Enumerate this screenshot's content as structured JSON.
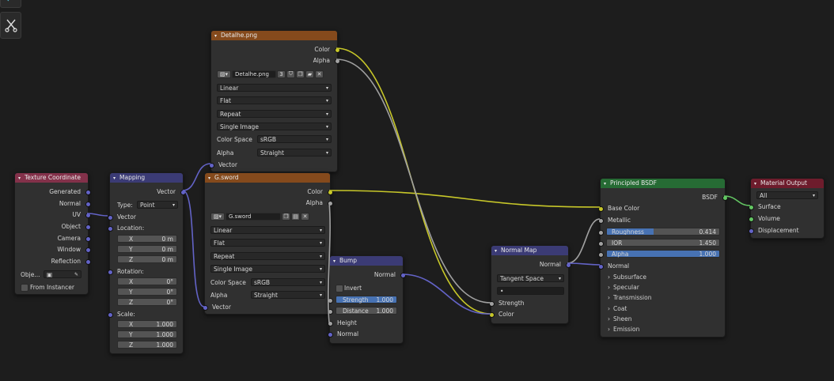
{
  "toolbar": {
    "top_icon": "node-tool-icon",
    "tool_icon": "cut-links-icon"
  },
  "nodes": {
    "texcoord": {
      "title": "Texture Coordinate",
      "outputs": [
        "Generated",
        "Normal",
        "UV",
        "Object",
        "Camera",
        "Window",
        "Reflection"
      ],
      "object_label": "Obje...",
      "from_instancer": "From Instancer",
      "header_color": "#83314a"
    },
    "mapping": {
      "title": "Mapping",
      "output": "Vector",
      "type_label": "Type:",
      "type_value": "Point",
      "input_vector": "Vector",
      "location_label": "Location:",
      "location": [
        {
          "axis": "X",
          "value": "0 m"
        },
        {
          "axis": "Y",
          "value": "0 m"
        },
        {
          "axis": "Z",
          "value": "0 m"
        }
      ],
      "rotation_label": "Rotation:",
      "rotation": [
        {
          "axis": "X",
          "value": "0°"
        },
        {
          "axis": "Y",
          "value": "0°"
        },
        {
          "axis": "Z",
          "value": "0°"
        }
      ],
      "scale_label": "Scale:",
      "scale": [
        {
          "axis": "X",
          "value": "1.000"
        },
        {
          "axis": "Y",
          "value": "1.000"
        },
        {
          "axis": "Z",
          "value": "1.000"
        }
      ],
      "header_color": "#3b3b75"
    },
    "detalhe": {
      "title": "Detalhe.png",
      "outputs": [
        "Color",
        "Alpha"
      ],
      "image_name": "Detalhe.png",
      "users": "3",
      "interpolation": "Linear",
      "projection": "Flat",
      "extension": "Repeat",
      "source": "Single Image",
      "color_space_label": "Color Space",
      "color_space": "sRGB",
      "alpha_label": "Alpha",
      "alpha": "Straight",
      "input_vector": "Vector",
      "header_color": "#854a1c"
    },
    "gsword": {
      "title": "G.sword",
      "outputs": [
        "Color",
        "Alpha"
      ],
      "image_name": "G.sword",
      "interpolation": "Linear",
      "projection": "Flat",
      "extension": "Repeat",
      "source": "Single Image",
      "color_space_label": "Color Space",
      "color_space": "sRGB",
      "alpha_label": "Alpha",
      "alpha": "Straight",
      "input_vector": "Vector",
      "header_color": "#854a1c"
    },
    "bump": {
      "title": "Bump",
      "output": "Normal",
      "invert": "Invert",
      "strength_label": "Strength",
      "strength": "1.000",
      "distance_label": "Distance",
      "distance": "1.000",
      "height": "Height",
      "normal": "Normal",
      "header_color": "#3b3b75"
    },
    "normalmap": {
      "title": "Normal Map",
      "output": "Normal",
      "space": "Tangent Space",
      "uv_value": "•",
      "strength": "Strength",
      "color": "Color",
      "header_color": "#3b3b75"
    },
    "principled": {
      "title": "Principled BSDF",
      "output": "BSDF",
      "base_color": "Base Color",
      "metallic": "Metallic",
      "roughness_label": "Roughness",
      "roughness": "0.414",
      "roughness_fraction": 0.414,
      "ior_label": "IOR",
      "ior": "1.450",
      "alpha_label": "Alpha",
      "alpha": "1.000",
      "normal": "Normal",
      "panels": [
        "Subsurface",
        "Specular",
        "Transmission",
        "Coat",
        "Sheen",
        "Emission"
      ],
      "header_color": "#266b34"
    },
    "output": {
      "title": "Material Output",
      "target": "All",
      "inputs": [
        "Surface",
        "Volume",
        "Displacement"
      ],
      "header_color": "#6e1c2c"
    }
  },
  "colors": {
    "wire_color": "#c7c729",
    "wire_vector": "#6363c7",
    "wire_float": "#a1a1a1",
    "wire_shader": "#63c763"
  }
}
